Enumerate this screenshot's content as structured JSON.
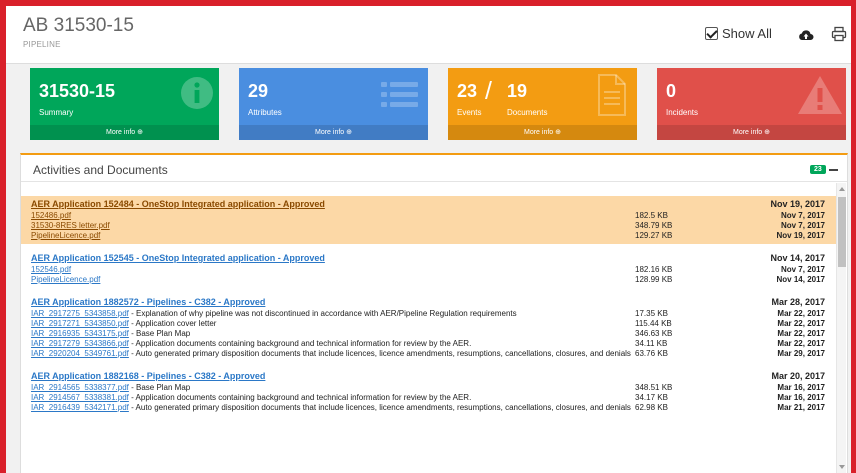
{
  "header": {
    "title": "AB 31530-15",
    "subtitle": "PIPELINE",
    "show_all_label": "Show All",
    "show_all_checked": true
  },
  "boxes": [
    {
      "number": "31530-15",
      "label": "Summary",
      "footer": "More info ⊕",
      "color": "#00a65a",
      "icon": "info-icon"
    },
    {
      "number": "29",
      "label": "Attributes",
      "footer": "More info ⊕",
      "color": "#4a8ee0",
      "icon": "list-icon"
    },
    {
      "number": "23",
      "number2": "19",
      "label": "Events",
      "label2": "Documents",
      "footer": "More info ⊕",
      "color": "#f39c12",
      "icon": "document-icon"
    },
    {
      "number": "0",
      "label": "Incidents",
      "footer": "More info ⊕",
      "color": "#e0504a",
      "icon": "warning-icon"
    }
  ],
  "panel": {
    "title": "Activities and Documents",
    "count": "23",
    "groups": [
      {
        "title": "AER Application 152484 - OneStop Integrated application - Approved",
        "date": "Nov 19, 2017",
        "highlight": true,
        "docs": [
          {
            "file": "152486.pdf",
            "desc": "",
            "size": "182.5 KB",
            "date": "Nov 7, 2017"
          },
          {
            "file": "31530-8RES letter.pdf",
            "desc": "",
            "size": "348.79 KB",
            "date": "Nov 7, 2017"
          },
          {
            "file": "PipelineLicence.pdf",
            "desc": "",
            "size": "129.27 KB",
            "date": "Nov 19, 2017"
          }
        ]
      },
      {
        "title": "AER Application 152545 - OneStop Integrated application - Approved",
        "date": "Nov 14, 2017",
        "highlight": false,
        "docs": [
          {
            "file": "152546.pdf",
            "desc": "",
            "size": "182.16 KB",
            "date": "Nov 7, 2017"
          },
          {
            "file": "PipelineLicence.pdf",
            "desc": "",
            "size": "128.99 KB",
            "date": "Nov 14, 2017"
          }
        ]
      },
      {
        "title": "AER Application 1882572 - Pipelines - C382 - Approved",
        "date": "Mar 28, 2017",
        "highlight": false,
        "docs": [
          {
            "file": "IAR_2917275_5343858.pdf",
            "desc": " - Explanation of why pipeline was not discontinued in accordance with AER/Pipeline Regulation requirements",
            "size": "17.35 KB",
            "date": "Mar 22, 2017"
          },
          {
            "file": "IAR_2917271_5343850.pdf",
            "desc": " - Application cover letter",
            "size": "115.44 KB",
            "date": "Mar 22, 2017"
          },
          {
            "file": "IAR_2916935_5343175.pdf",
            "desc": " - Base Plan Map",
            "size": "346.63 KB",
            "date": "Mar 22, 2017"
          },
          {
            "file": "IAR_2917279_5343866.pdf",
            "desc": " - Application documents containing background and technical information for review by the AER.",
            "size": "34.11 KB",
            "date": "Mar 22, 2017"
          },
          {
            "file": "IAR_2920204_5349761.pdf",
            "desc": " - Auto generated primary disposition documents that include licences, licence amendments, resumptions, cancellations, closures, and denials",
            "size": "63.76 KB",
            "date": "Mar 29, 2017"
          }
        ]
      },
      {
        "title": "AER Application 1882168 - Pipelines - C382 - Approved",
        "date": "Mar 20, 2017",
        "highlight": false,
        "docs": [
          {
            "file": "IAR_2914565_5338377.pdf",
            "desc": " - Base Plan Map",
            "size": "348.51 KB",
            "date": "Mar 16, 2017"
          },
          {
            "file": "IAR_2914567_5338381.pdf",
            "desc": " - Application documents containing background and technical information for review by the AER.",
            "size": "34.17 KB",
            "date": "Mar 16, 2017"
          },
          {
            "file": "IAR_2916439_5342171.pdf",
            "desc": " - Auto generated primary disposition documents that include licences, licence amendments, resumptions, cancellations, closures, and denials",
            "size": "62.98 KB",
            "date": "Mar 21, 2017"
          }
        ]
      }
    ]
  }
}
